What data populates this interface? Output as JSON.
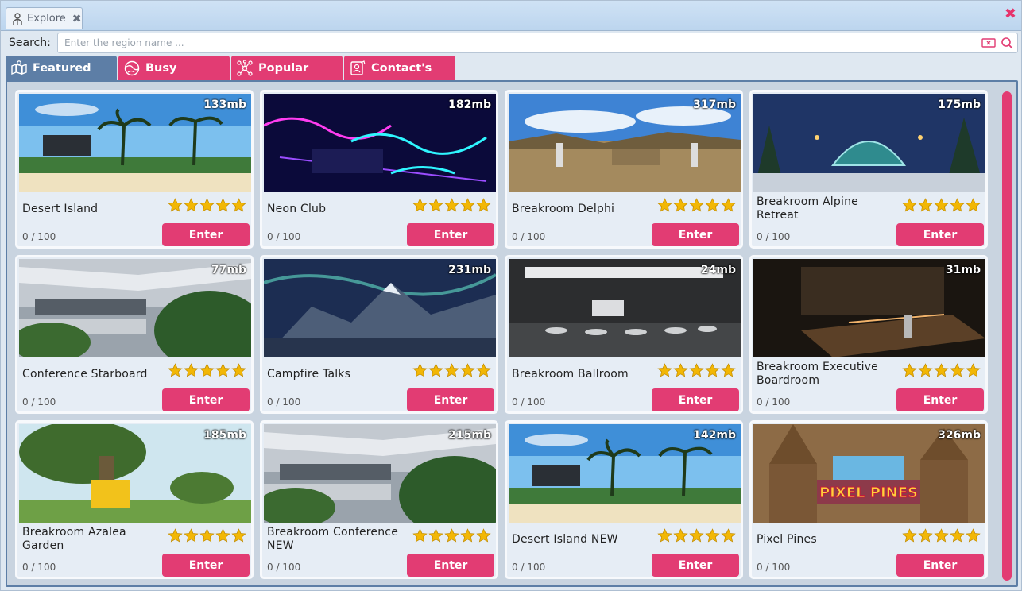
{
  "window": {
    "tab_label": "Explore",
    "tab_icon": "user-network-icon",
    "close_icon": "close-x-icon"
  },
  "search": {
    "label": "Search:",
    "placeholder": "Enter the region name ..."
  },
  "tabs": [
    {
      "label": "Featured",
      "icon": "map-icon",
      "active": true
    },
    {
      "label": "Busy",
      "icon": "globe-icon",
      "active": false
    },
    {
      "label": "Popular",
      "icon": "network-icon",
      "active": false
    },
    {
      "label": "Contact's",
      "icon": "contacts-icon",
      "active": false
    }
  ],
  "enter_label": "Enter",
  "star_color": "#f2b705",
  "accent_color": "#e23c73",
  "regions": [
    {
      "name": "Desert Island",
      "size": "133mb",
      "count": "0 / 100",
      "rating": 5,
      "scene": "beach"
    },
    {
      "name": "Neon Club",
      "size": "182mb",
      "count": "0 / 100",
      "rating": 5,
      "scene": "neon"
    },
    {
      "name": "Breakroom Delphi",
      "size": "317mb",
      "count": "0 / 100",
      "rating": 5,
      "scene": "delphi"
    },
    {
      "name": "Breakroom Alpine Retreat",
      "size": "175mb",
      "count": "0 / 100",
      "rating": 5,
      "scene": "alpine"
    },
    {
      "name": "Conference Starboard",
      "size": "77mb",
      "count": "0 / 100",
      "rating": 5,
      "scene": "conference"
    },
    {
      "name": "Campfire Talks",
      "size": "231mb",
      "count": "0 / 100",
      "rating": 5,
      "scene": "aurora"
    },
    {
      "name": "Breakroom Ballroom",
      "size": "24mb",
      "count": "0 / 100",
      "rating": 5,
      "scene": "ballroom"
    },
    {
      "name": "Breakroom Executive Boardroom",
      "size": "31mb",
      "count": "0 / 100",
      "rating": 5,
      "scene": "boardroom"
    },
    {
      "name": "Breakroom Azalea Garden",
      "size": "185mb",
      "count": "0 / 100",
      "rating": 5,
      "scene": "garden"
    },
    {
      "name": "Breakroom Conference NEW",
      "size": "215mb",
      "count": "0 / 100",
      "rating": 5,
      "scene": "conference"
    },
    {
      "name": "Desert Island NEW",
      "size": "142mb",
      "count": "0 / 100",
      "rating": 5,
      "scene": "beach"
    },
    {
      "name": "Pixel Pines",
      "size": "326mb",
      "count": "0 / 100",
      "rating": 5,
      "scene": "pixel"
    }
  ]
}
